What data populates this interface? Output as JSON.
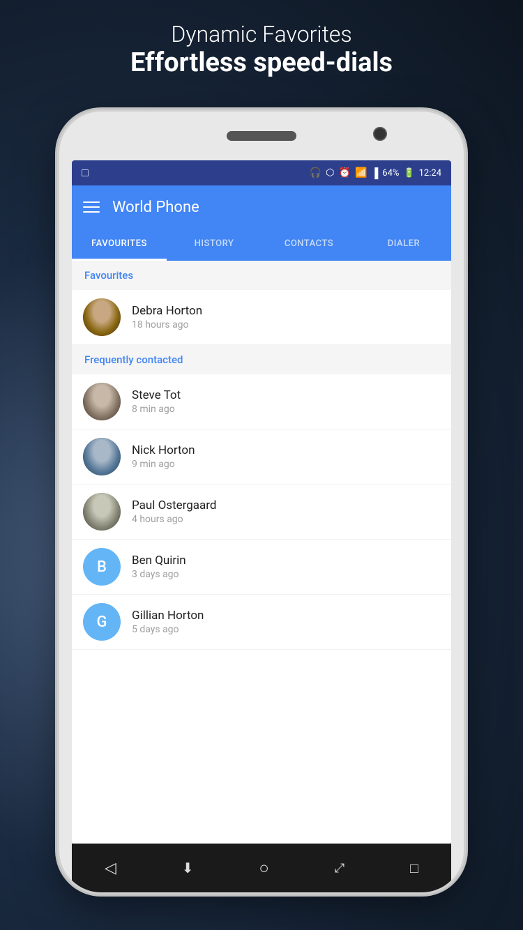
{
  "page": {
    "background_subtitle": "Dynamic Favorites",
    "background_title": "Effortless speed-dials"
  },
  "status_bar": {
    "battery_percent": "64%",
    "time": "12:24",
    "icons": [
      "headphone",
      "bluetooth",
      "alarm",
      "wifi",
      "signal"
    ]
  },
  "app_bar": {
    "title": "World Phone"
  },
  "tabs": [
    {
      "label": "FAVOURITES",
      "active": true
    },
    {
      "label": "HISTORY",
      "active": false
    },
    {
      "label": "CONTACTS",
      "active": false
    },
    {
      "label": "DIALER",
      "active": false
    }
  ],
  "sections": [
    {
      "title": "Favourites",
      "contacts": [
        {
          "name": "Debra Horton",
          "time": "18 hours ago",
          "avatar_type": "photo",
          "avatar_key": "debra",
          "initial": ""
        }
      ]
    },
    {
      "title": "Frequently contacted",
      "contacts": [
        {
          "name": "Steve Tot",
          "time": "8 min ago",
          "avatar_type": "photo",
          "avatar_key": "steve",
          "initial": ""
        },
        {
          "name": "Nick Horton",
          "time": "9 min ago",
          "avatar_type": "photo",
          "avatar_key": "nick",
          "initial": ""
        },
        {
          "name": "Paul Ostergaard",
          "time": "4 hours ago",
          "avatar_type": "photo",
          "avatar_key": "paul",
          "initial": ""
        },
        {
          "name": "Ben Quirin",
          "time": "3 days ago",
          "avatar_type": "letter",
          "avatar_key": "ben",
          "initial": "B"
        },
        {
          "name": "Gillian Horton",
          "time": "5 days ago",
          "avatar_type": "letter",
          "avatar_key": "gillian",
          "initial": "G"
        }
      ]
    }
  ],
  "nav_buttons": [
    "◁",
    "⊕",
    "○",
    "⤢",
    "□"
  ]
}
